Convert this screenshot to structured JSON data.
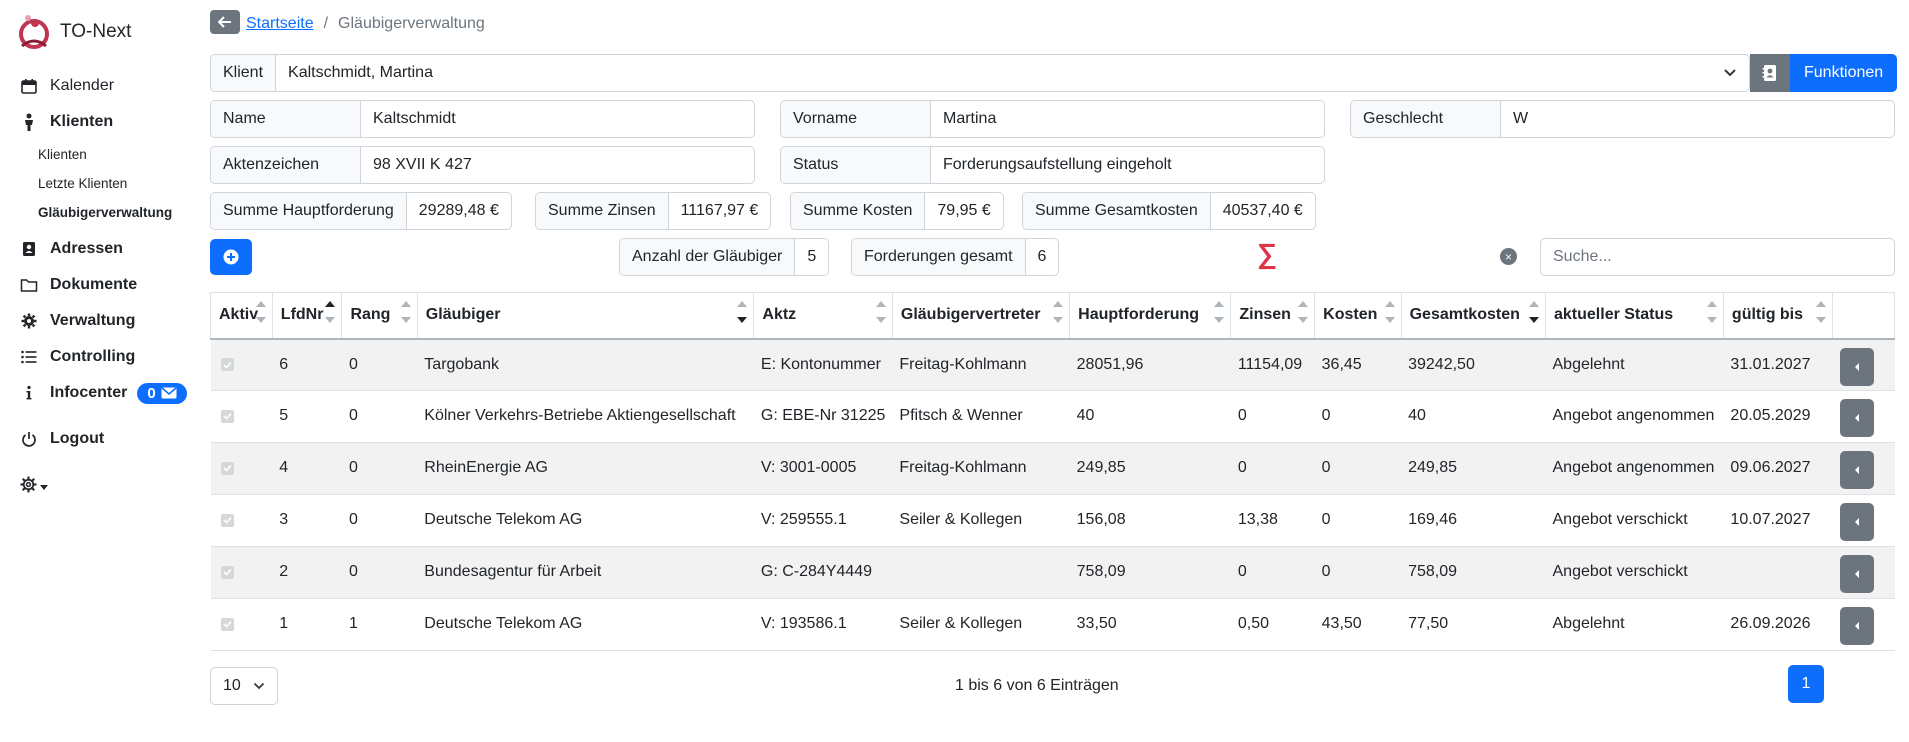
{
  "app": {
    "name": "TO-Next"
  },
  "sidebar": {
    "items": [
      {
        "label": "Kalender"
      },
      {
        "label": "Klienten"
      },
      {
        "label": "Klienten"
      },
      {
        "label": "Letzte Klienten"
      },
      {
        "label": "Gläubigerverwaltung"
      },
      {
        "label": "Adressen"
      },
      {
        "label": "Dokumente"
      },
      {
        "label": "Verwaltung"
      },
      {
        "label": "Controlling"
      },
      {
        "label": "Infocenter",
        "badge": "0"
      },
      {
        "label": "Logout"
      }
    ]
  },
  "breadcrumb": {
    "home": "Startseite",
    "current": "Gläubigerverwaltung"
  },
  "client": {
    "label": "Klient",
    "value": "Kaltschmidt, Martina"
  },
  "functions_label": "Funktionen",
  "fields": {
    "name": {
      "label": "Name",
      "value": "Kaltschmidt"
    },
    "vorname": {
      "label": "Vorname",
      "value": "Martina"
    },
    "geschlecht": {
      "label": "Geschlecht",
      "value": "W"
    },
    "aktenzeichen": {
      "label": "Aktenzeichen",
      "value": "98 XVII K 427"
    },
    "status": {
      "label": "Status",
      "value": "Forderungsaufstellung eingeholt"
    }
  },
  "sums": {
    "haupt": {
      "label": "Summe Hauptforderung",
      "value": "29289,48 €"
    },
    "zinsen": {
      "label": "Summe Zinsen",
      "value": "11167,97 €"
    },
    "kosten": {
      "label": "Summe Kosten",
      "value": "79,95 €"
    },
    "gesamt": {
      "label": "Summe Gesamtkosten",
      "value": "40537,40 €"
    }
  },
  "counts": {
    "glaeubiger": {
      "label": "Anzahl der Gläubiger",
      "value": "5"
    },
    "forderungen": {
      "label": "Forderungen gesamt",
      "value": "6"
    }
  },
  "sigma": "∑",
  "search": {
    "placeholder": "Suche..."
  },
  "table": {
    "headers": [
      "Aktiv",
      "LfdNr",
      "Rang",
      "Gläubiger",
      "Aktz",
      "Gläubigervertreter",
      "Hauptforderung",
      "Zinsen",
      "Kosten",
      "Gesamtkosten",
      "aktueller Status",
      "gültig bis"
    ],
    "rows": [
      [
        "",
        "6",
        "0",
        "Targobank",
        "E: Kontonummer",
        "Freitag-Kohlmann",
        "28051,96",
        "11154,09",
        "36,45",
        "39242,50",
        "Abgelehnt",
        "31.01.2027"
      ],
      [
        "",
        "5",
        "0",
        "Kölner Verkehrs-Betriebe Aktiengesellschaft",
        "G: EBE-Nr 31225",
        "Pfitsch & Wenner",
        "40",
        "0",
        "0",
        "40",
        "Angebot angenommen",
        "20.05.2029"
      ],
      [
        "",
        "4",
        "0",
        "RheinEnergie AG",
        "V: 3001-0005",
        "Freitag-Kohlmann",
        "249,85",
        "0",
        "0",
        "249,85",
        "Angebot angenommen",
        "09.06.2027"
      ],
      [
        "",
        "3",
        "0",
        "Deutsche Telekom AG",
        "V: 259555.1",
        "Seiler & Kollegen",
        "156,08",
        "13,38",
        "0",
        "169,46",
        "Angebot verschickt",
        "10.07.2027"
      ],
      [
        "",
        "2",
        "0",
        "Bundesagentur für Arbeit",
        "G: C-284Y4449",
        "",
        "758,09",
        "0",
        "0",
        "758,09",
        "Angebot verschickt",
        ""
      ],
      [
        "",
        "1",
        "1",
        "Deutsche Telekom AG",
        "V: 193586.1",
        "Seiler & Kollegen",
        "33,50",
        "0,50",
        "43,50",
        "77,50",
        "Abgelehnt",
        "26.09.2026"
      ]
    ]
  },
  "footer": {
    "page_length": "10",
    "info": "1 bis 6 von 6 Einträgen",
    "current_page": "1"
  },
  "colors": {
    "primary": "#0d6efd",
    "secondary": "#6c757d",
    "sigma": "#dc3545"
  }
}
